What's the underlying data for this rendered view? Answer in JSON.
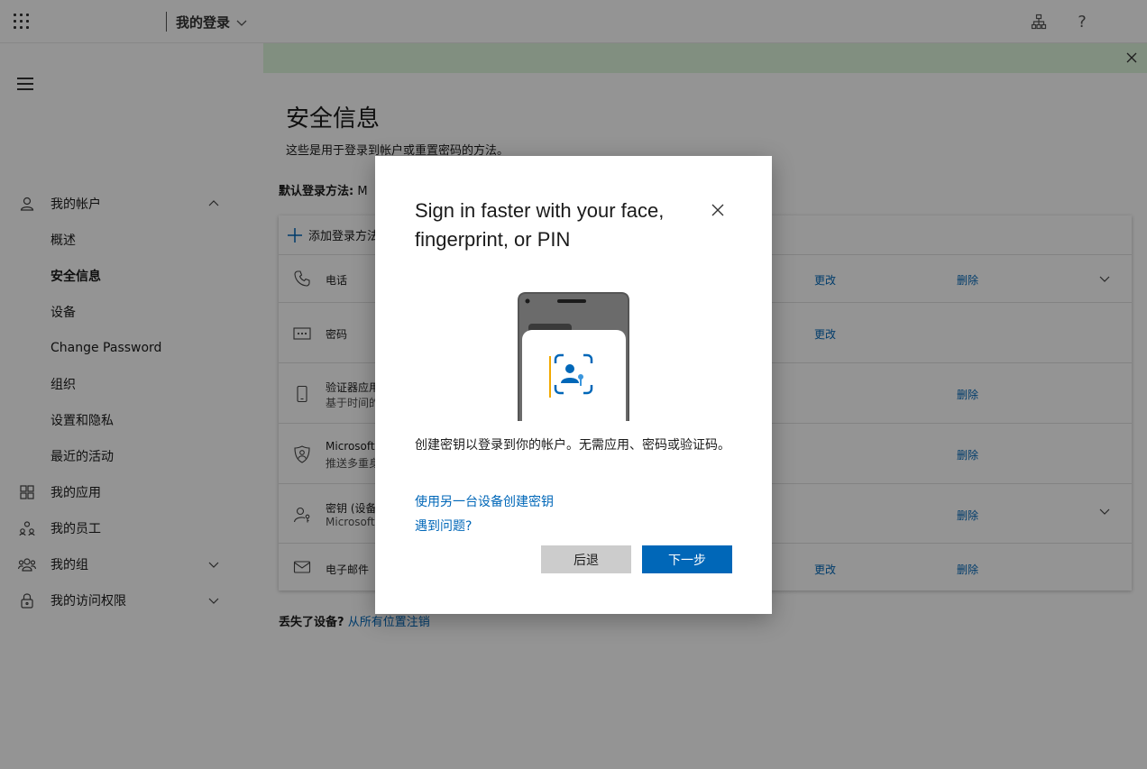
{
  "header": {
    "app_title": "我的登录"
  },
  "sidebar": {
    "items": [
      {
        "label": "我的帐户"
      },
      {
        "label": "概述"
      },
      {
        "label": "安全信息"
      },
      {
        "label": "设备"
      },
      {
        "label": "Change Password"
      },
      {
        "label": "组织"
      },
      {
        "label": "设置和隐私"
      },
      {
        "label": "最近的活动"
      },
      {
        "label": "我的应用"
      },
      {
        "label": "我的员工"
      },
      {
        "label": "我的组"
      },
      {
        "label": "我的访问权限"
      }
    ]
  },
  "main": {
    "title": "安全信息",
    "subtitle": "这些是用于登录到帐户或重置密码的方法。",
    "default_method_label": "默认登录方法:",
    "default_method_value": "M",
    "add_method": "添加登录方法",
    "methods": [
      {
        "name": "电话",
        "sub": "",
        "change": "更改",
        "delete": "删除"
      },
      {
        "name": "密码",
        "sub": "",
        "change": "更改",
        "delete": ""
      },
      {
        "name": "验证器应用",
        "sub": "基于时间的",
        "change": "",
        "delete": "删除"
      },
      {
        "name": "Microsoft A",
        "sub": "推送多重身",
        "change": "",
        "delete": "删除"
      },
      {
        "name": "密钥 (设备",
        "sub": "Microsoft A",
        "change": "",
        "delete": "删除"
      },
      {
        "name": "电子邮件",
        "sub": "",
        "change": "更改",
        "delete": "删除"
      }
    ],
    "lost_device_label": "丢失了设备?",
    "lost_device_link": "从所有位置注销"
  },
  "dialog": {
    "title": "Sign in faster with your face, fingerprint, or PIN",
    "description": "创建密钥以登录到你的帐户。无需应用、密码或验证码。",
    "link_other_device": "使用另一台设备创建密钥",
    "link_problem": "遇到问题?",
    "back_label": "后退",
    "next_label": "下一步"
  },
  "colors": {
    "accent": "#0067b8",
    "banner": "#dff6dd",
    "overlay": "rgba(0,0,0,0.42)"
  }
}
